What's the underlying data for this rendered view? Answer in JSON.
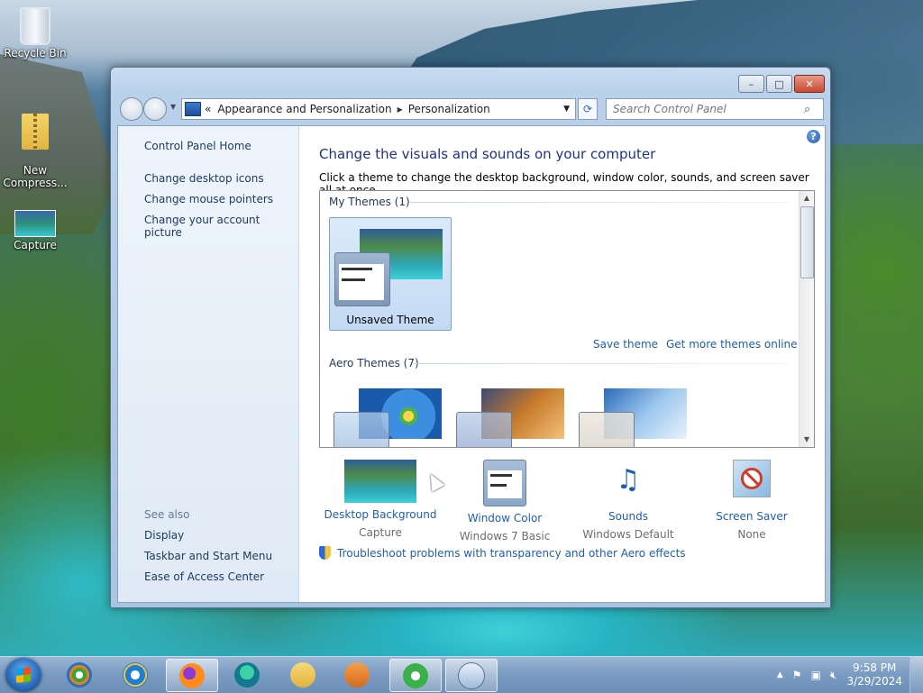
{
  "desktop": {
    "icons": [
      {
        "label": "Recycle Bin",
        "icon": "recycle-bin-icon"
      },
      {
        "label": "New\nCompress...",
        "icon": "zip-folder-icon"
      },
      {
        "label": "Capture",
        "icon": "image-file-icon"
      }
    ]
  },
  "window": {
    "caption_buttons": {
      "minimize": "–",
      "maximize": "□",
      "close": "✕"
    },
    "address": {
      "prefix": "«",
      "crumbs": [
        "Appearance and Personalization",
        "Personalization"
      ],
      "separator": "▶"
    },
    "search": {
      "placeholder": "Search Control Panel"
    }
  },
  "left_pane": {
    "home": "Control Panel Home",
    "links": [
      "Change desktop icons",
      "Change mouse pointers",
      "Change your account picture"
    ],
    "see_also_title": "See also",
    "see_also": [
      "Display",
      "Taskbar and Start Menu",
      "Ease of Access Center"
    ]
  },
  "content": {
    "title": "Change the visuals and sounds on your computer",
    "subtitle": "Click a theme to change the desktop background, window color, sounds, and screen saver all at once.",
    "my_themes_header": "My Themes (1)",
    "unsaved_theme": "Unsaved Theme",
    "save_theme": "Save theme",
    "get_more": "Get more themes online",
    "aero_header": "Aero Themes (7)",
    "bottom": [
      {
        "label": "Desktop Background",
        "value": "Capture",
        "icon": "desktop-background-icon"
      },
      {
        "label": "Window Color",
        "value": "Windows 7 Basic",
        "icon": "window-color-icon"
      },
      {
        "label": "Sounds",
        "value": "Windows Default",
        "icon": "sounds-icon"
      },
      {
        "label": "Screen Saver",
        "value": "None",
        "icon": "screen-saver-icon"
      }
    ],
    "troubleshoot": "Troubleshoot problems with transparency and other Aero effects"
  },
  "taskbar": {
    "items": [
      "start-button",
      "windows-media-center",
      "internet-explorer",
      "firefox",
      "edge",
      "file-explorer",
      "media-player",
      "cloud-app",
      "control-panel"
    ],
    "active": [
      "firefox",
      "cloud-app",
      "control-panel"
    ],
    "clock_time": "9:58 PM",
    "clock_date": "3/29/2024"
  },
  "colors": {
    "link": "#1f5eae",
    "title": "#1e3287",
    "taskbar": "#7b9cc2"
  }
}
